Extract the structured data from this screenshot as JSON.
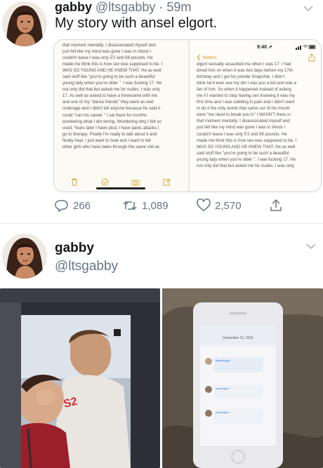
{
  "tweet1": {
    "display_name": "gabby",
    "handle": "@ltsgabby",
    "separator": "·",
    "time": "59m",
    "text": "My story with ansel elgort.",
    "notes_left_lines": [
      "that moment mentally. I disassociated myself and",
      "just felt like my mind was gone I was in shock I",
      "couldn't leave I was only 5'2 and 98 pounds. He",
      "made me think this is how sex was supposed to be. I",
      "WAS SO YOUNG AND HE KNEW THAT. He as well",
      "said stuff like \"you're going to be such a beautiful",
      "young lady when you're older \". I was fucking 17. He",
      "not only did that but asked me for nudes. I was only",
      "17. As well as asked to have a threesome with me",
      "and one of my \"dance friends\" they were as well",
      "underage and I didn't tell anyone because he said it",
      "could \"ruin his career \" I sat there for months",
      "wondering what I did wrong. Wondering why I felt so",
      "used. Years later I have ptsd, I have panic attacks I",
      "go to therapy. Finally I'm ready to talk about it and",
      "finally heal. I just want to heal and I want to tell",
      "other girls who have been through the same shit as"
    ],
    "notes_right_time": "9:40",
    "notes_back_label": "Notes",
    "notes_right_lines": [
      "elgort sexually assaulted me when I was 17. I had",
      "dmed him on when it was two days before my 17th",
      "birthday and I got his private Snapchat. I didn't",
      "think he'd ever see my dm I was just a kid and was a",
      "fan of him. So when it happened instead of asking",
      "me if I wanted to stop having sex knowing it was my",
      "first time and I was sobbing in pain and I didn't want",
      "to do it the only words that came out of his mouth",
      "were \"we need to break you in\" I WASN'T there in",
      "that moment mentally. I disassociated myself and",
      "just felt like my mind was gone I was in shock I",
      "couldn't leave I was only 5'2 and 98 pounds. He",
      "made me think this is how sex was supposed to be. I",
      "WAS SO YOUNG AND HE KNEW THAT. He as well",
      "said stuff like \"you're going to be such a beautiful",
      "young lady when you're older \". I was fucking 17. He",
      "not only did that but asked me for nudes. I was only"
    ],
    "reply_count": "266",
    "retweet_count": "1,089",
    "like_count": "2,570"
  },
  "tweet2": {
    "display_name": "gabby",
    "handle": "@ltsgabby",
    "phone_date": "December 21, 2011",
    "chat": [
      {
        "user": "itsgabbyyyy",
        "text": "I love you so much my birthday is tomorrow and you are probably never going to see"
      },
      {
        "user": "anselelgort",
        "text": "How could I not notice a cutie? c Happy B day"
      },
      {
        "user": "anselelgort",
        "text": "Snapchat me \"anseisn\" it is my personal snapchat file dont give it out"
      }
    ]
  },
  "colors": {
    "text_primary": "#14171a",
    "text_secondary": "#657786",
    "divider": "#e6ecf0",
    "notes_accent": "#d9a227"
  }
}
